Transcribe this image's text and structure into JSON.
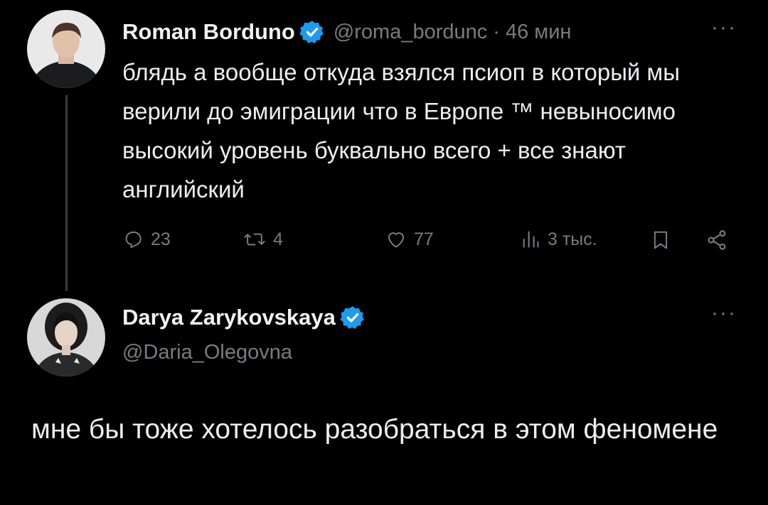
{
  "tweet": {
    "author_name": "Roman Borduno",
    "author_handle": "@roma_bordunc",
    "separator": "·",
    "time": "46 мин",
    "more": "···",
    "text": "блядь а вообще откуда взялся псиоп в который мы верили до эмиграции что в Европе ™ невыносимо высокий уровень буквально всего + все знают английский",
    "stats": {
      "replies": "23",
      "retweets": "4",
      "likes": "77",
      "views": "3 тыс."
    },
    "icons": {
      "verified": "verified-badge-icon",
      "reply": "reply-icon",
      "retweet": "retweet-icon",
      "like": "heart-icon",
      "views": "views-chart-icon",
      "bookmark": "bookmark-icon",
      "share": "share-icon"
    }
  },
  "reply": {
    "author_name": "Darya Zarykovskaya",
    "author_handle": "@Daria_Olegovna",
    "more": "···",
    "text": "мне бы тоже хотелось разобраться в этом феномене"
  },
  "colors": {
    "background": "#000000",
    "text": "#e7e9ea",
    "muted": "#787b80",
    "verified": "#1d9bf0",
    "thread_line": "#3a3d40"
  }
}
